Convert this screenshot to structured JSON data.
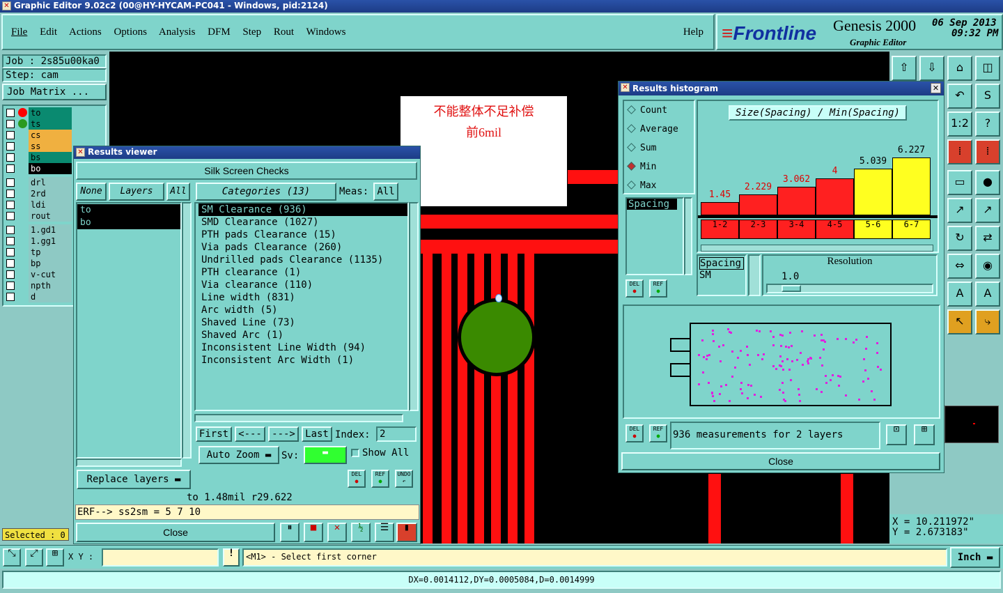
{
  "window_title": "Graphic Editor 9.02c2 (00@HY-HYCAM-PC041 - Windows, pid:2124)",
  "menu": [
    "File",
    "Edit",
    "Actions",
    "Options",
    "Analysis",
    "DFM",
    "Step",
    "Rout",
    "Windows"
  ],
  "help": "Help",
  "brand": {
    "logo": "Frontline",
    "product": "Genesis 2000",
    "subtitle": "Graphic Editor",
    "date": "06 Sep 2013",
    "time": "09:32 PM"
  },
  "job": {
    "job": "Job : 2s85u00ka0",
    "step": "Step: cam",
    "matrix": "Job Matrix ..."
  },
  "layers": [
    {
      "name": "to",
      "color": "#0a8a70",
      "dot": "#ff0000"
    },
    {
      "name": "ts",
      "color": "#0a8a70",
      "dot": "#2a9a20"
    },
    {
      "name": "cs",
      "color": "#f0b040",
      "dot": ""
    },
    {
      "name": "ss",
      "color": "#f0b040",
      "dot": ""
    },
    {
      "name": "bs",
      "color": "#0a8a70",
      "dot": ""
    },
    {
      "name": "bo",
      "color": "#000000",
      "dot": ""
    },
    {
      "name": "drl",
      "color": "",
      "dot": ""
    },
    {
      "name": "2rd",
      "color": "",
      "dot": ""
    },
    {
      "name": "ldi",
      "color": "",
      "dot": ""
    },
    {
      "name": "rout",
      "color": "",
      "dot": ""
    },
    {
      "name": "1.gd1",
      "color": "",
      "dot": ""
    },
    {
      "name": "1.gg1",
      "color": "",
      "dot": ""
    },
    {
      "name": "tp",
      "color": "",
      "dot": ""
    },
    {
      "name": "bp",
      "color": "",
      "dot": ""
    },
    {
      "name": "v-cut",
      "color": "",
      "dot": ""
    },
    {
      "name": "npth",
      "color": "",
      "dot": ""
    },
    {
      "name": "d",
      "color": "",
      "dot": ""
    }
  ],
  "selected": "Selected : 0",
  "note": {
    "line1": "不能整体不足补偿",
    "line2": "前6mil"
  },
  "viewer": {
    "title": "Results viewer",
    "header": "Silk Screen Checks",
    "none": "None",
    "layers_label": "Layers",
    "all": "All",
    "categories_label": "Categories (13)",
    "meas": "Meas:",
    "meas_all": "All",
    "layer_items": [
      "to",
      "bo"
    ],
    "categories": [
      "SM Clearance (936)",
      "SMD Clearance (1027)",
      "PTH pads Clearance (15)",
      "Via pads Clearance (260)",
      "Undrilled pads Clearance (1135)",
      "PTH clearance (1)",
      "Via clearance (110)",
      "Line width (831)",
      "Arc width (5)",
      "Shaved Line (73)",
      "Shaved Arc (1)",
      "Inconsistent Line Width (94)",
      "Inconsistent Arc Width (1)"
    ],
    "first": "First",
    "prev": "<---",
    "next": "--->",
    "last": "Last",
    "index_label": "Index:",
    "index_value": "2",
    "auto_zoom": "Auto Zoom",
    "sv": "Sv:",
    "show_all": "Show All",
    "replace_layers": "Replace layers",
    "status": "to 1.48mil  r29.622",
    "erf": "ERF--> ss2sm = 5 7 10",
    "close": "Close",
    "del": "DEL",
    "ref": "REF",
    "undo": "UNDO"
  },
  "histogram": {
    "title": "Results histogram",
    "modes": [
      "Count",
      "Average",
      "Sum",
      "Min",
      "Max"
    ],
    "selected_mode": "Min",
    "chart_title": "Size(Spacing) / Min(Spacing)",
    "spacing_item": "Spacing",
    "spacing_label": "Spacing",
    "sm_label": "SM",
    "resolution_label": "Resolution",
    "resolution_value": "1.0",
    "measurements": "936 measurements for 2 layers",
    "close": "Close",
    "del": "DEL",
    "ref": "REF"
  },
  "chart_data": {
    "type": "bar",
    "categories": [
      "1-2",
      "2-3",
      "3-4",
      "4-5",
      "5-6",
      "6-7"
    ],
    "values": [
      1.45,
      2.229,
      3.062,
      4,
      5.039,
      6.227
    ],
    "value_labels": [
      "1.45",
      "2.229",
      "3.062",
      "4",
      "5.039",
      "6.227"
    ],
    "colors": [
      "#ff2020",
      "#ff2020",
      "#ff2020",
      "#ff2020",
      "#ffff20",
      "#ffff20"
    ],
    "title": "Size(Spacing) / Min(Spacing)",
    "ylim": [
      0,
      6.227
    ]
  },
  "coords": {
    "x": "X  = 10.211972\"",
    "y": "Y  = 2.673183\""
  },
  "xy_label": "X Y :",
  "prompt": "<M1> - Select first corner",
  "units": "Inch",
  "bottom_status": "DX=0.0014112,DY=0.0005084,D=0.0014999"
}
